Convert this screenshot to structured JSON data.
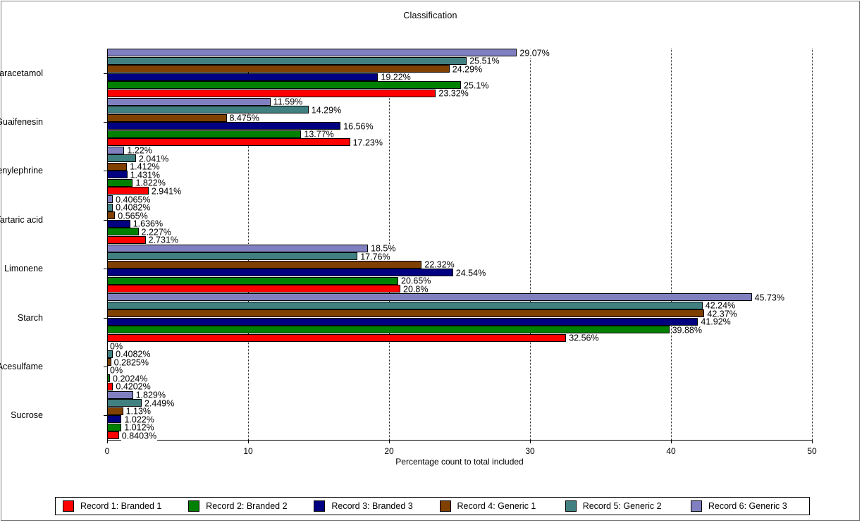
{
  "chart_data": {
    "type": "bar",
    "orientation": "horizontal",
    "title": "Classification",
    "xlabel": "Percentage count to total included",
    "ylabel": "",
    "xlim": [
      0,
      50
    ],
    "xticks": [
      0,
      10,
      20,
      30,
      40,
      50
    ],
    "xtick_labels": [
      "0",
      "10",
      "20",
      "30",
      "40",
      "50"
    ],
    "grid": true,
    "grid_axis": "x",
    "legend_position": "bottom",
    "value_suffix": "%",
    "categories": [
      "Paracetamol",
      "Guaifenesin",
      "Phenylephrine",
      "Tartaric acid",
      "Limonene",
      "Starch",
      "Acesulfame",
      "Sucrose"
    ],
    "series": [
      {
        "name": "Record 1: Branded 1",
        "color": "#FF0000",
        "values": [
          23.32,
          17.23,
          2.941,
          2.731,
          20.8,
          32.56,
          0.4202,
          0.8403
        ],
        "labels": [
          "23.32%",
          "17.23%",
          "2.941%",
          "2.731%",
          "20.8%",
          "32.56%",
          "0.4202%",
          "0.8403%"
        ]
      },
      {
        "name": "Record 2: Branded 2",
        "color": "#008000",
        "values": [
          25.1,
          13.77,
          1.822,
          2.227,
          20.65,
          39.88,
          0.2024,
          1.012
        ],
        "labels": [
          "25.1%",
          "13.77%",
          "1.822%",
          "2.227%",
          "20.65%",
          "39.88%",
          "0.2024%",
          "1.012%"
        ]
      },
      {
        "name": "Record 3: Branded 3",
        "color": "#000080",
        "values": [
          19.22,
          16.56,
          1.431,
          1.636,
          24.54,
          41.92,
          0,
          1.022
        ],
        "labels": [
          "19.22%",
          "16.56%",
          "1.431%",
          "1.636%",
          "24.54%",
          "41.92%",
          "0%",
          "1.022%"
        ]
      },
      {
        "name": "Record 4: Generic 1",
        "color": "#804000",
        "values": [
          24.29,
          8.475,
          1.412,
          0.565,
          22.32,
          42.37,
          0.2825,
          1.13
        ],
        "labels": [
          "24.29%",
          "8.475%",
          "1.412%",
          "0.565%",
          "22.32%",
          "42.37%",
          "0.2825%",
          "1.13%"
        ]
      },
      {
        "name": "Record 5: Generic 2",
        "color": "#408080",
        "values": [
          25.51,
          14.29,
          2.041,
          0.4082,
          17.76,
          42.24,
          0.4082,
          2.449
        ],
        "labels": [
          "25.51%",
          "14.29%",
          "2.041%",
          "0.4082%",
          "17.76%",
          "42.24%",
          "0.4082%",
          "2.449%"
        ]
      },
      {
        "name": "Record 6: Generic 3",
        "color": "#8080C0",
        "values": [
          29.07,
          11.59,
          1.22,
          0.4065,
          18.5,
          45.73,
          0,
          1.829
        ],
        "labels": [
          "29.07%",
          "11.59%",
          "1.22%",
          "0.4065%",
          "18.5%",
          "45.73%",
          "0%",
          "1.829%"
        ]
      }
    ]
  }
}
